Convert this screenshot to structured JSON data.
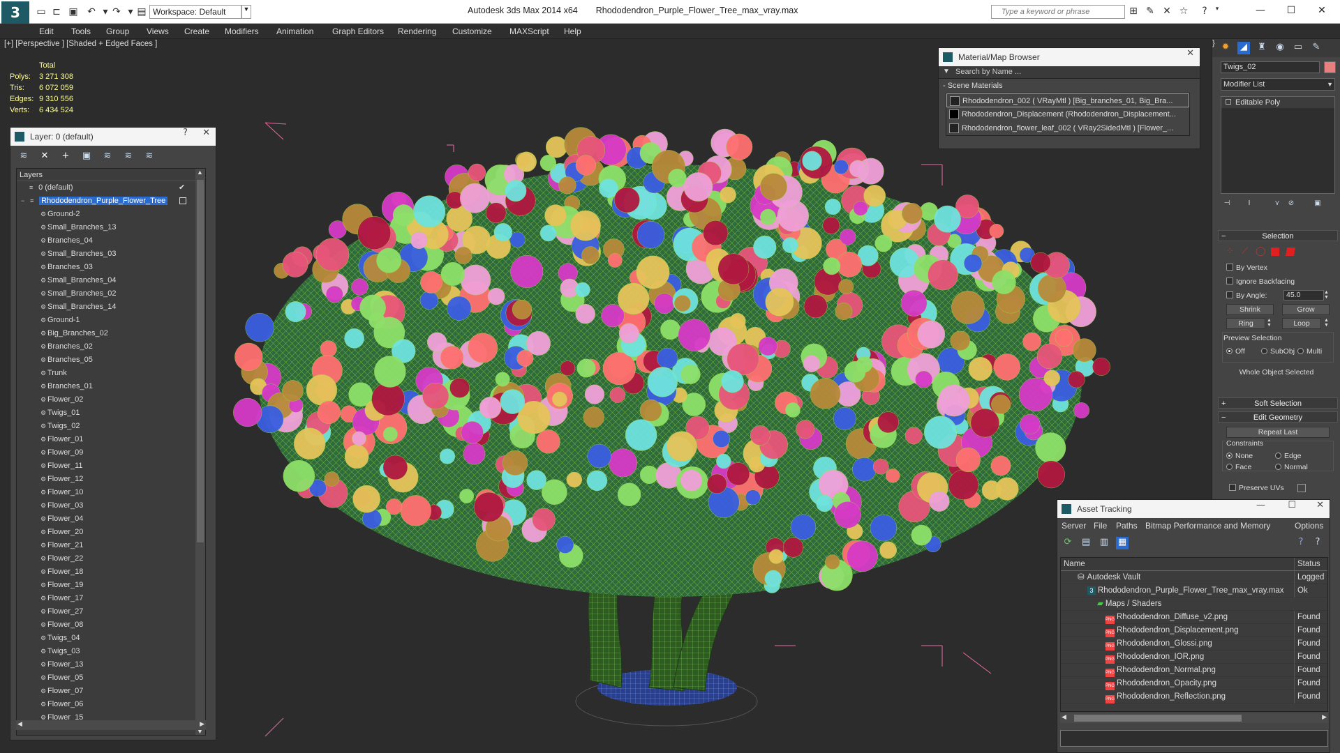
{
  "titlebar": {
    "workspace": "Workspace: Default",
    "app_name": "Autodesk 3ds Max  2014 x64",
    "file_name": "Rhododendron_Purple_Flower_Tree_max_vray.max",
    "search_placeholder": "Type a keyword or phrase"
  },
  "menu": [
    "Edit",
    "Tools",
    "Group",
    "Views",
    "Create",
    "Modifiers",
    "Animation",
    "Graph Editors",
    "Rendering",
    "Customize",
    "MAXScript",
    "Help"
  ],
  "viewport": {
    "label": "[+] [Perspective ] [Shaded + Edged Faces ]",
    "stats_header": "Total",
    "stats": [
      {
        "label": "Polys:",
        "value": "3 271 308"
      },
      {
        "label": "Tris:",
        "value": "6 072 059"
      },
      {
        "label": "Edges:",
        "value": "9 310 556"
      },
      {
        "label": "Verts:",
        "value": "6 434 524"
      }
    ]
  },
  "layer_panel": {
    "title": "Layer: 0 (default)",
    "help": "?",
    "column_header": "Layers",
    "default_layer": "0 (default)",
    "selected_layer": "Rhododendron_Purple_Flower_Tree",
    "objects": [
      "Ground-2",
      "Small_Branches_13",
      "Branches_04",
      "Small_Branches_03",
      "Branches_03",
      "Small_Branches_04",
      "Small_Branches_02",
      "Small_Branches_14",
      "Ground-1",
      "Big_Branches_02",
      "Branches_02",
      "Branches_05",
      "Trunk",
      "Branches_01",
      "Flower_02",
      "Twigs_01",
      "Twigs_02",
      "Flower_01",
      "Flower_09",
      "Flower_11",
      "Flower_12",
      "Flower_10",
      "Flower_03",
      "Flower_04",
      "Flower_20",
      "Flower_21",
      "Flower_22",
      "Flower_18",
      "Flower_19",
      "Flower_17",
      "Flower_27",
      "Flower_08",
      "Twigs_04",
      "Twigs_03",
      "Flower_13",
      "Flower_05",
      "Flower_07",
      "Flower_06",
      "Flower_15"
    ]
  },
  "material_browser": {
    "title": "Material/Map Browser",
    "search_placeholder": "Search by Name ...",
    "section": "- Scene Materials",
    "materials": [
      "Rhododendron_002  ( VRayMtl ) [Big_branches_01, Big_Bra...",
      "Rhododendron_Displacement (Rhododendron_Displacement...",
      "Rhododendron_flower_leaf_002  ( VRay2SidedMtl ) [Flower_..."
    ]
  },
  "command_panel": {
    "object_name": "Twigs_02",
    "object_color": "#e88080",
    "modifier_list": "Modifier List",
    "stack_item": "Editable Poly",
    "selection": {
      "header": "Selection",
      "by_vertex": "By Vertex",
      "ignore_backfacing": "Ignore Backfacing",
      "by_angle": "By Angle:",
      "angle_value": "45.0",
      "shrink": "Shrink",
      "grow": "Grow",
      "ring": "Ring",
      "loop": "Loop",
      "preview_label": "Preview Selection",
      "preview_off": "Off",
      "preview_subobj": "SubObj",
      "preview_multi": "Multi",
      "status": "Whole Object Selected"
    },
    "soft_selection": "Soft Selection",
    "edit_geometry": "Edit Geometry",
    "repeat_last": "Repeat Last",
    "constraints_label": "Constraints",
    "c_none": "None",
    "c_edge": "Edge",
    "c_face": "Face",
    "c_normal": "Normal",
    "preserve_uvs": "Preserve UVs"
  },
  "asset_tracking": {
    "title": "Asset Tracking",
    "menu": [
      "Server",
      "File",
      "Paths",
      "Bitmap Performance and Memory",
      "Options"
    ],
    "col_name": "Name",
    "col_status": "Status",
    "rows": [
      {
        "name": "Autodesk Vault",
        "status": "Logged"
      },
      {
        "name": "Rhododendron_Purple_Flower_Tree_max_vray.max",
        "status": "Ok"
      },
      {
        "name": "Maps / Shaders",
        "status": ""
      },
      {
        "name": "Rhododendron_Diffuse_v2.png",
        "status": "Found"
      },
      {
        "name": "Rhododendron_Displacement.png",
        "status": "Found"
      },
      {
        "name": "Rhododendron_Glossi.png",
        "status": "Found"
      },
      {
        "name": "Rhododendron_IOR.png",
        "status": "Found"
      },
      {
        "name": "Rhododendron_Normal.png",
        "status": "Found"
      },
      {
        "name": "Rhododendron_Opacity.png",
        "status": "Found"
      },
      {
        "name": "Rhododendron_Reflection.png",
        "status": "Found"
      }
    ]
  },
  "flower_colors": [
    "#e8557a",
    "#d63ac6",
    "#6fe3de",
    "#e6c45a",
    "#b01840",
    "#8de06a",
    "#f0a0d8",
    "#3a5ee0",
    "#b88a3a",
    "#ff7070"
  ]
}
